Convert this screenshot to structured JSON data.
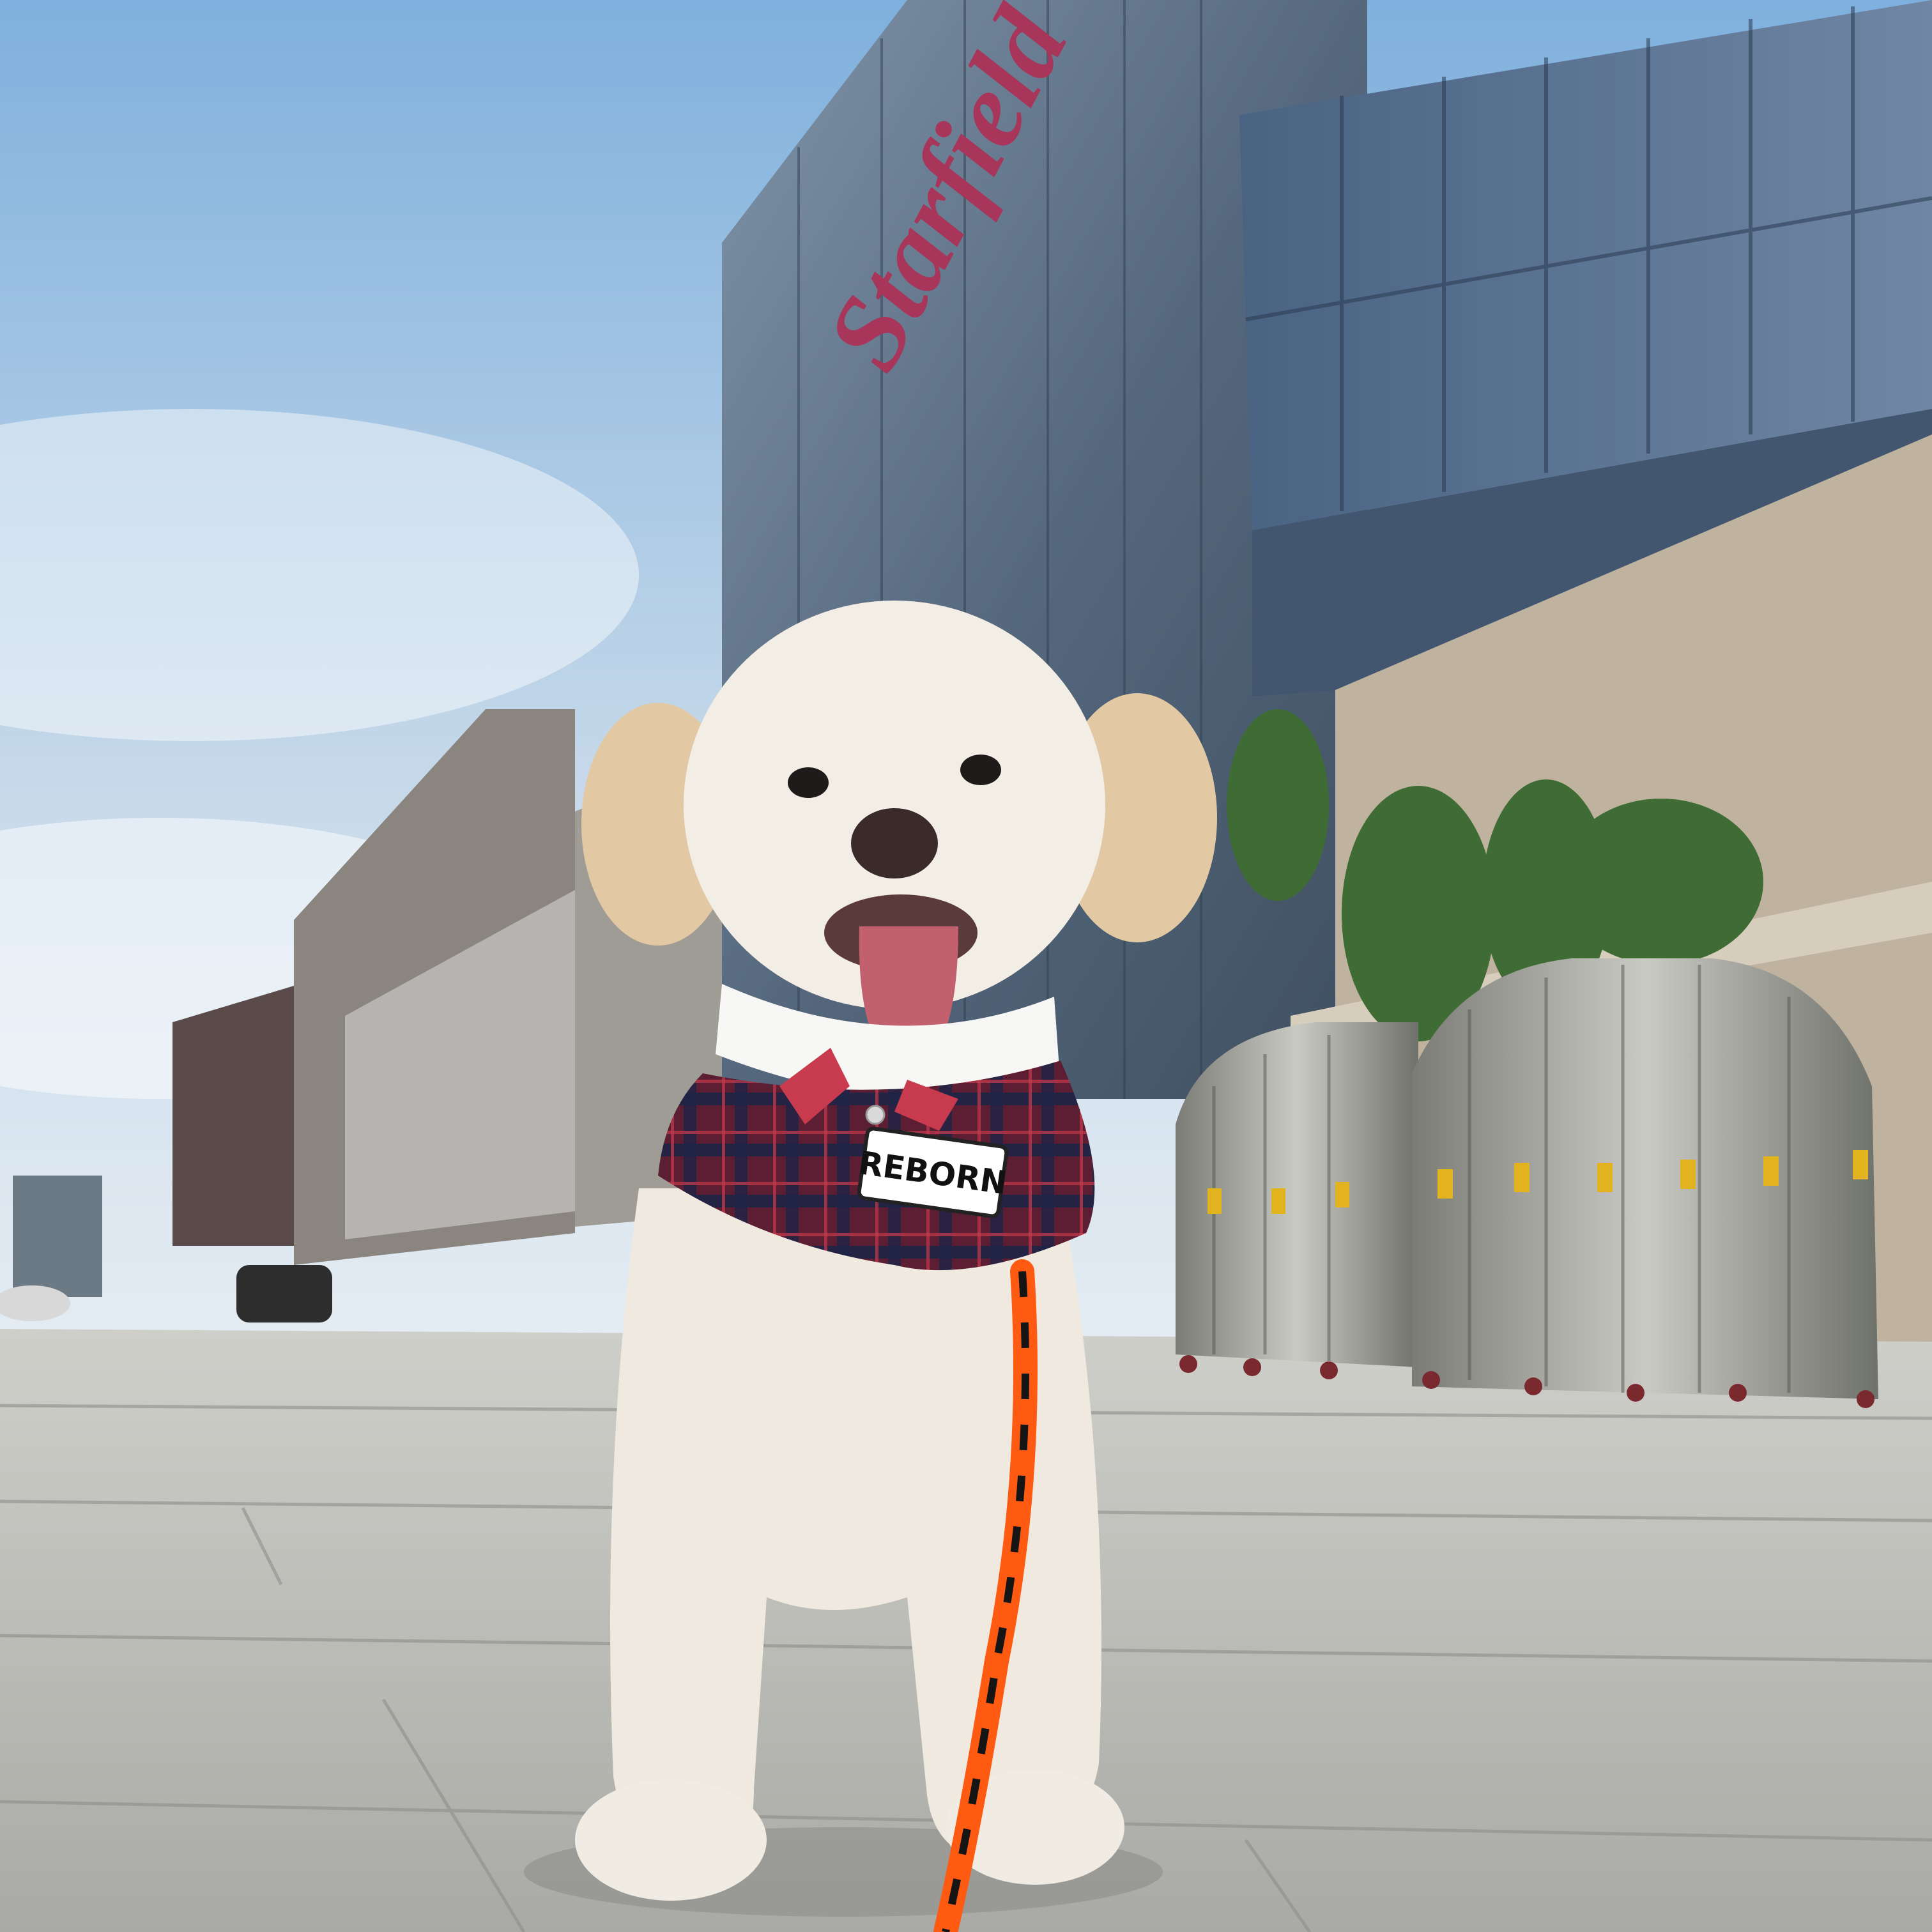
{
  "photo": {
    "building_sign": "Starfield",
    "collar_patch": "REBORN"
  },
  "colors": {
    "sky_top": "#7fb0dd",
    "sky_bottom": "#dfe9f2",
    "glass": "#5b6f86",
    "sign": "#a8355a",
    "pavement": "#b9b9b4",
    "fur": "#efe9df",
    "ear": "#e2c9a4",
    "tartan": "#5b1e33",
    "leash": "#ff5a12"
  }
}
